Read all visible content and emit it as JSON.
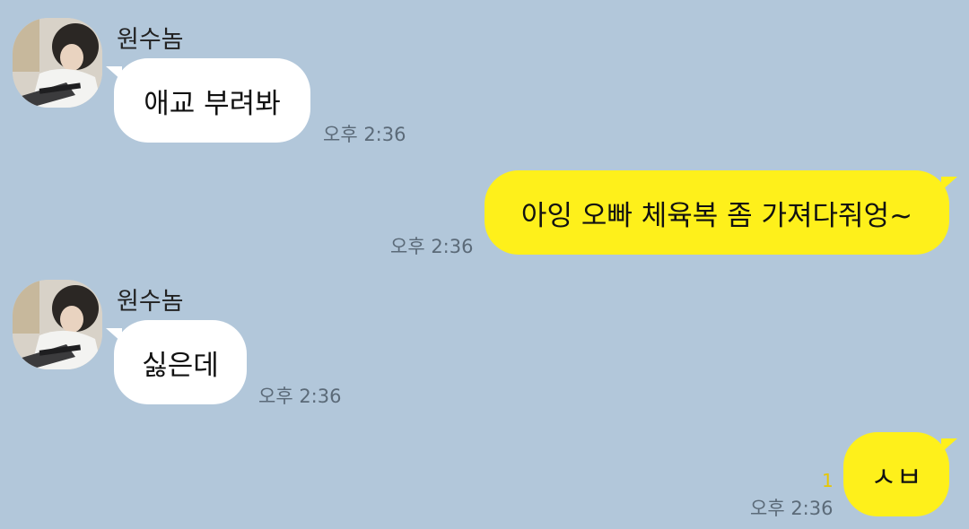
{
  "colors": {
    "background": "#b2c7da",
    "incoming_bubble": "#ffffff",
    "outgoing_bubble": "#fef01b",
    "time_text": "#5b6a78",
    "unread_count": "#e8c700"
  },
  "messages": [
    {
      "direction": "incoming",
      "sender": "원수놈",
      "text": "애교 부려봐",
      "time": "오후 2:36"
    },
    {
      "direction": "outgoing",
      "text": "아잉 오빠 체육복 좀 가져다줘엉~",
      "time": "오후 2:36"
    },
    {
      "direction": "incoming",
      "sender": "원수놈",
      "text": "싫은데",
      "time": "오후 2:36"
    },
    {
      "direction": "outgoing",
      "text": "ㅅㅂ",
      "time": "오후 2:36",
      "unread": "1"
    }
  ]
}
